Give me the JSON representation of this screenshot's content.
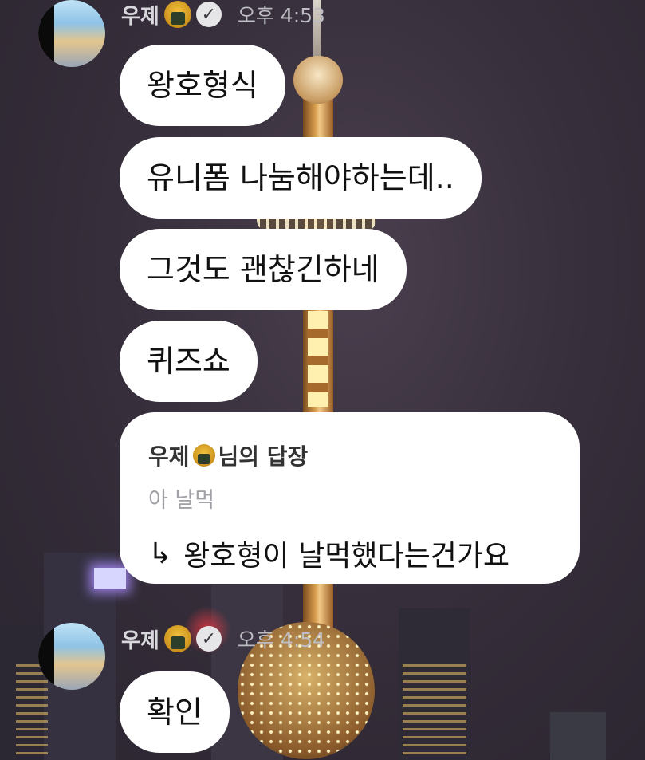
{
  "messages_group_1": {
    "sender": "우제",
    "time": "오후 4:53",
    "bubbles": [
      "왕호형식",
      "유니폼 나눔해야하는데..",
      "그것도 괜찮긴하네",
      "퀴즈쇼"
    ],
    "reply": {
      "reply_to_name": "우제",
      "reply_to_suffix": "님의 답장",
      "quoted_text": "아 날먹",
      "arrow": "↳",
      "text": "왕호형이 날먹했다는건가요"
    }
  },
  "messages_group_2": {
    "sender": "우제",
    "time": "오후 4:54",
    "bubbles": [
      "확인"
    ]
  },
  "icons": {
    "avatar": "avatar-image",
    "sender_emoji": "onigiri-icon",
    "verified": "verified-check-icon"
  },
  "colors": {
    "bubble_bg": "#ffffff",
    "bubble_text": "#111111",
    "quoted_text": "#a0a0a6",
    "header_text": "#d9d9dd"
  }
}
